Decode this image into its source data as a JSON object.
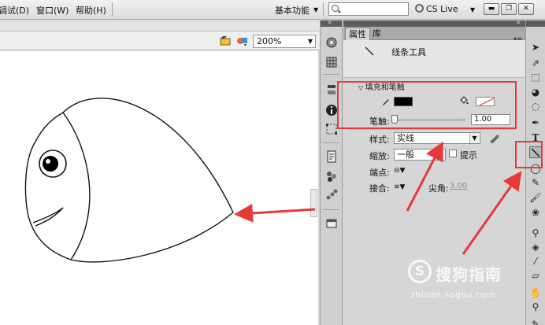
{
  "menu": {
    "items": [
      "调试(D)",
      "窗口(W)",
      "帮助(H)"
    ],
    "workspace": "基本功能",
    "search_placeholder": "",
    "cs_live": "CS Live"
  },
  "stage": {
    "zoom": "200%"
  },
  "properties": {
    "tabs": [
      "属性",
      "库"
    ],
    "tool_name": "线条工具",
    "section_title": "填充和笔触",
    "stroke_label": "笔触:",
    "stroke_value": "1.00",
    "style_label": "样式:",
    "style_value": "实线",
    "scale_label": "缩放:",
    "scale_value": "一般",
    "hint_label": "提示",
    "cap_label": "端点:",
    "join_label": "接合:",
    "miter_label": "尖角:",
    "miter_value": "3.00",
    "stroke_color": "#000000",
    "fill_color": "#ffffff"
  },
  "watermark": {
    "text": "搜狗指南",
    "url": "zhinan.sogou.com"
  },
  "annotation_color": "#e53a3a"
}
